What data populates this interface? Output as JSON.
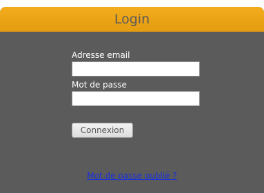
{
  "header": {
    "title": "Login"
  },
  "form": {
    "email_label": "Adresse email",
    "email_value": "",
    "password_label": "Mot de passe",
    "password_value": "",
    "submit_label": "Connexion",
    "forgot_link": "Mot de passe oublié ?"
  },
  "colors": {
    "header_bg": "#eea418",
    "panel_bg": "#5b5b5b",
    "link": "#1a2fe0"
  }
}
